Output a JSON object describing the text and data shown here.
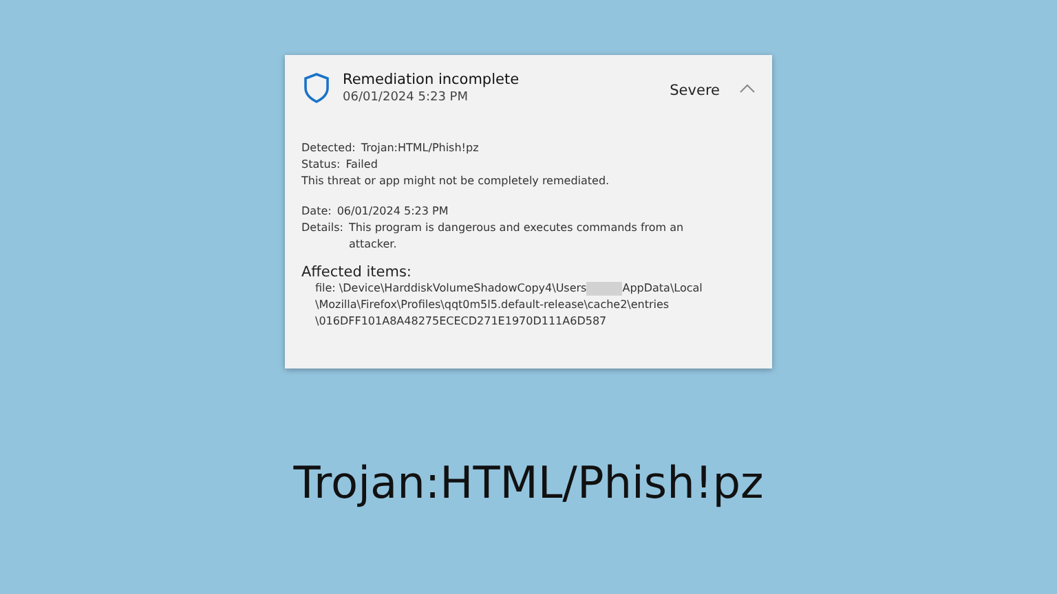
{
  "alert": {
    "title": "Remediation incomplete",
    "time": "06/01/2024 5:23 PM",
    "severity": "Severe",
    "expanded": true,
    "fields": [
      {
        "label": "Detected:",
        "value": "Trojan:HTML/Phish!pz"
      },
      {
        "label": "Status:",
        "value": "Failed"
      }
    ],
    "note": "This threat or app might not be completely remediated.",
    "fields2": [
      {
        "label": "Date:",
        "value": "06/01/2024 5:23 PM"
      },
      {
        "label": "Details:",
        "value": "This program is dangerous and executes commands from an attacker."
      }
    ],
    "affected_heading": "Affected items:",
    "path_start": "file: \\Device\\HarddiskVolumeShadowCopy4\\Users",
    "path_after_redaction": "AppData\\Local",
    "path_lines": [
      "\\Mozilla\\Firefox\\Profiles\\qqt0m5l5.default-release\\cache2\\entries",
      "\\016DFF101A8A48275ECECD271E1970D111A6D587"
    ]
  },
  "caption": "Trojan:HTML/Phish!pz"
}
